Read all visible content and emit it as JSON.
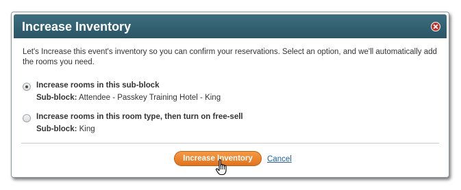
{
  "dialog": {
    "title": "Increase Inventory",
    "intro": "Let's Increase this event's inventory so you can confirm your reservations. Select an option, and we'll automatically add the rooms you need.",
    "options": [
      {
        "label": "Increase rooms in this sub-block",
        "sub_key": "Sub-block:",
        "sub_value": "Attendee - Passkey Training Hotel - King",
        "selected": true
      },
      {
        "label": "Increase rooms in this room type, then turn on free-sell",
        "sub_key": "Sub-block:",
        "sub_value": "King",
        "selected": false
      }
    ],
    "primary_button": "Increase Inventory",
    "cancel_link": "Cancel"
  },
  "icons": {
    "close": "close-icon",
    "cursor": "hand-pointer-icon"
  },
  "colors": {
    "titlebar": "#2f5e6e",
    "primary_button": "#e97f2a",
    "link": "#1f5fa8",
    "close": "#c0302a"
  }
}
